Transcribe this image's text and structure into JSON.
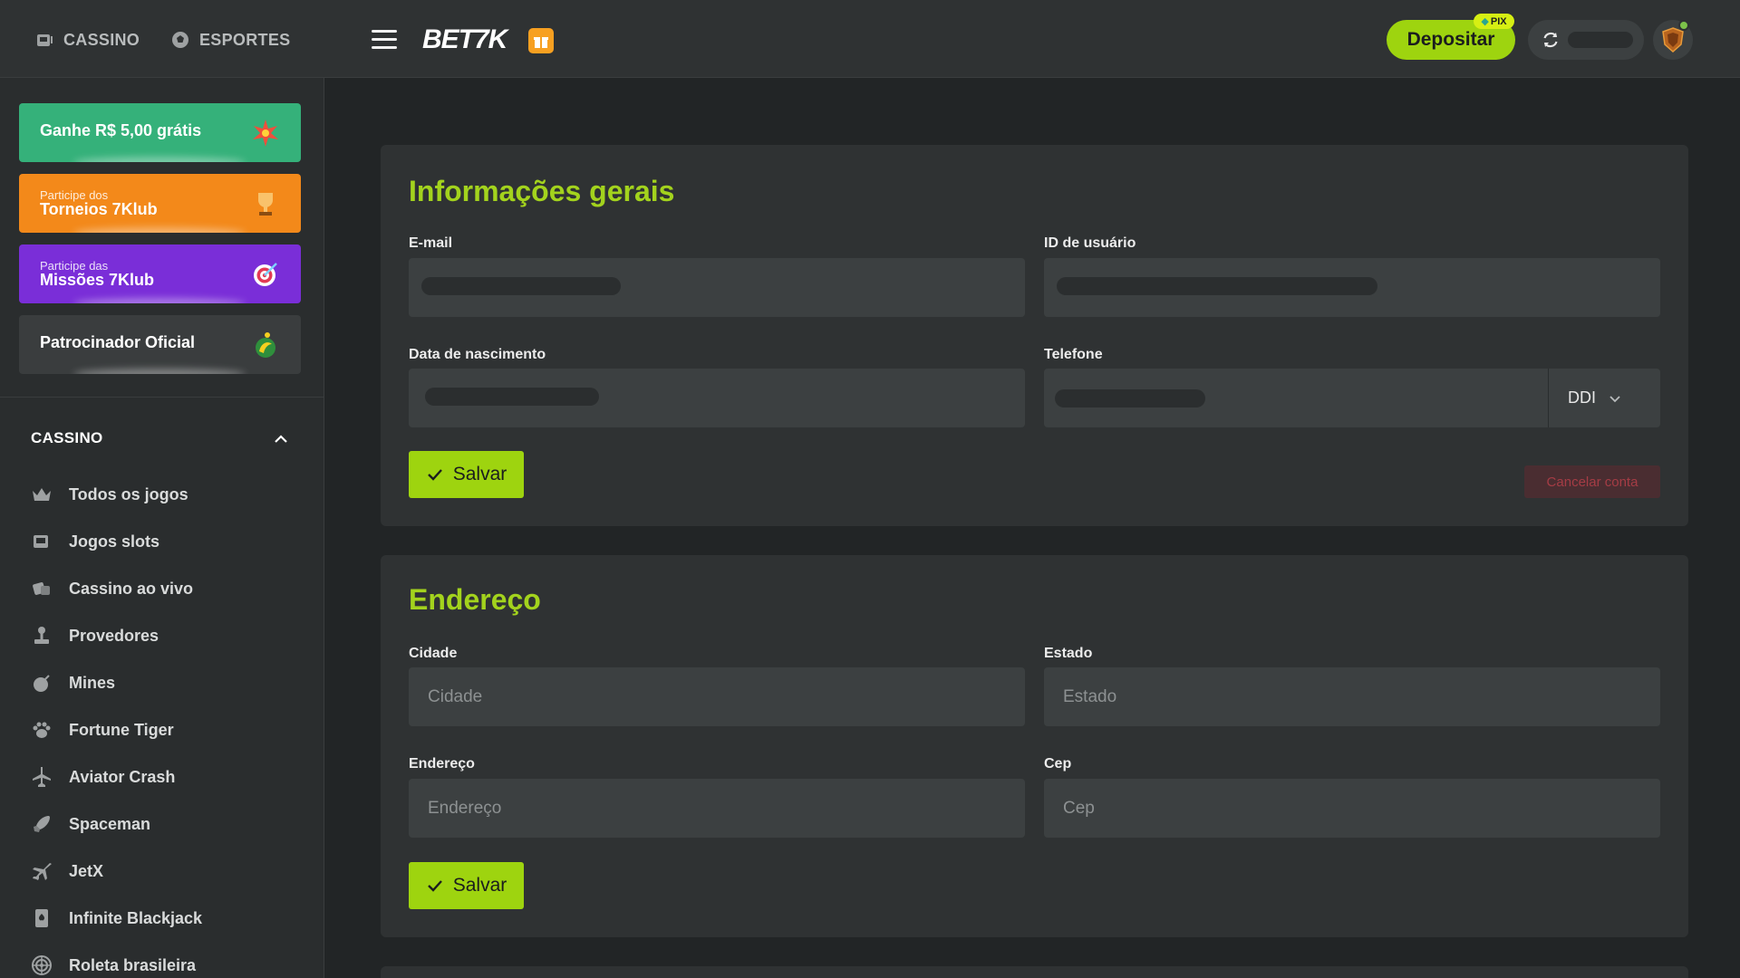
{
  "topbar": {
    "nav": [
      {
        "label": "CASSINO",
        "icon": "slot-machine-icon"
      },
      {
        "label": "ESPORTES",
        "icon": "soccer-ball-icon"
      }
    ],
    "logo_text": "BET7K",
    "deposit_label": "Depositar",
    "pix_label": "PIX",
    "accent_color": "#9ed40f"
  },
  "sidebar": {
    "promos": [
      {
        "title": "Ganhe R$ 5,00 grátis"
      },
      {
        "small": "Participe dos",
        "big": "Torneios 7Klub"
      },
      {
        "small": "Participe das",
        "big": "Missões 7Klub"
      },
      {
        "title": "Patrocinador Oficial"
      }
    ],
    "section_title": "CASSINO",
    "items": [
      {
        "label": "Todos os jogos",
        "icon": "crown-icon"
      },
      {
        "label": "Jogos slots",
        "icon": "slot-machine-icon"
      },
      {
        "label": "Cassino ao vivo",
        "icon": "dice-icon"
      },
      {
        "label": "Provedores",
        "icon": "joystick-icon"
      },
      {
        "label": "Mines",
        "icon": "bomb-icon"
      },
      {
        "label": "Fortune Tiger",
        "icon": "paw-icon"
      },
      {
        "label": "Aviator Crash",
        "icon": "airplane-icon"
      },
      {
        "label": "Spaceman",
        "icon": "rocket-icon"
      },
      {
        "label": "JetX",
        "icon": "jet-icon"
      },
      {
        "label": "Infinite Blackjack",
        "icon": "card-icon"
      },
      {
        "label": "Roleta brasileira",
        "icon": "roulette-icon"
      }
    ]
  },
  "general": {
    "title": "Informações gerais",
    "email_label": "E-mail",
    "user_id_label": "ID de usuário",
    "birth_label": "Data de nascimento",
    "phone_label": "Telefone",
    "ddi_label": "DDI",
    "save_label": "Salvar",
    "cancel_label": "Cancelar conta"
  },
  "address": {
    "title": "Endereço",
    "city_label": "Cidade",
    "city_placeholder": "Cidade",
    "state_label": "Estado",
    "state_placeholder": "Estado",
    "address_label": "Endereço",
    "address_placeholder": "Endereço",
    "cep_label": "Cep",
    "cep_placeholder": "Cep",
    "save_label": "Salvar"
  }
}
